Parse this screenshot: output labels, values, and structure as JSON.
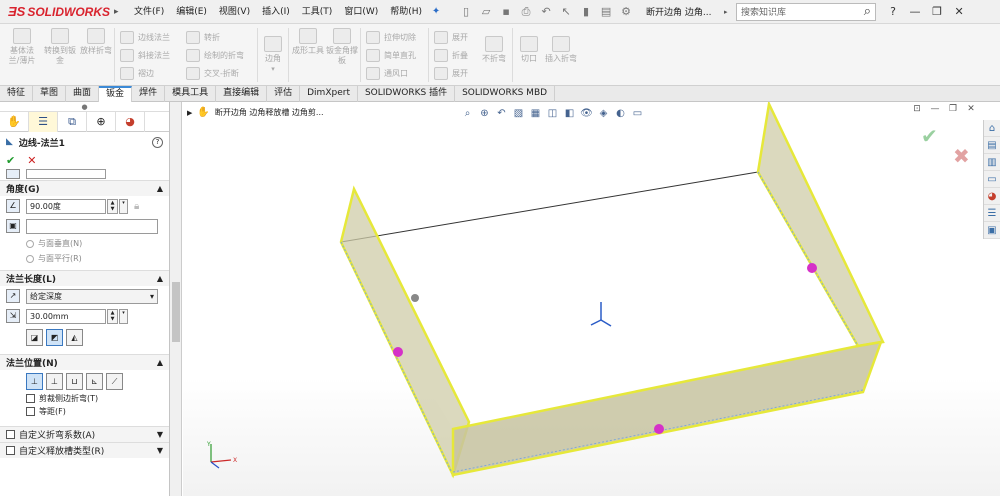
{
  "app": {
    "logo_text": "SOLIDWORKS",
    "logo_mark": "ƎS"
  },
  "menu": [
    "文件(F)",
    "编辑(E)",
    "视图(V)",
    "插入(I)",
    "工具(T)",
    "窗口(W)",
    "帮助(H)"
  ],
  "document_title": "断开边角 边角...",
  "search": {
    "placeholder": "搜索知识库"
  },
  "ribbon": {
    "big_buttons": [
      "基体法兰/薄片",
      "转换到钣金",
      "放样折弯",
      "边角",
      "成形工具",
      "钣金角撑板",
      "折叠",
      "不折弯",
      "切口",
      "插入折弯"
    ],
    "small_buttons": [
      "边线法兰",
      "斜接法兰",
      "褶边",
      "转折",
      "绘制的折弯",
      "交叉-折断",
      "拉伸切除",
      "简单直孔",
      "通风口",
      "展开",
      "展开"
    ]
  },
  "tabs": [
    "特征",
    "草图",
    "曲面",
    "钣金",
    "焊件",
    "模具工具",
    "直接编辑",
    "评估",
    "DimXpert",
    "SOLIDWORKS 插件",
    "SOLIDWORKS MBD"
  ],
  "active_tab": "钣金",
  "property_manager": {
    "title": "边线-法兰1",
    "angle_group": {
      "title": "角度(G)",
      "angle_value": "90.00度",
      "radio_options": [
        "与面垂直(N)",
        "与面平行(R)"
      ]
    },
    "length_group": {
      "title": "法兰长度(L)",
      "end_condition": "给定深度",
      "length_value": "30.00mm"
    },
    "position_group": {
      "title": "法兰位置(N)",
      "checkboxes": [
        "剪裁侧边折弯(T)",
        "等距(F)"
      ]
    },
    "custom_groups": [
      "自定义折弯系数(A)",
      "自定义释放槽类型(R)"
    ]
  },
  "viewport": {
    "feature_tree_label": "断开边角 边角释放槽 边角剪..."
  },
  "colors": {
    "accent": "#3c8ad6",
    "logo": "#d9232e",
    "flange_edge": "#eaec3a",
    "flange_fill": "#c7c4a0",
    "handle": "#d531c8"
  }
}
